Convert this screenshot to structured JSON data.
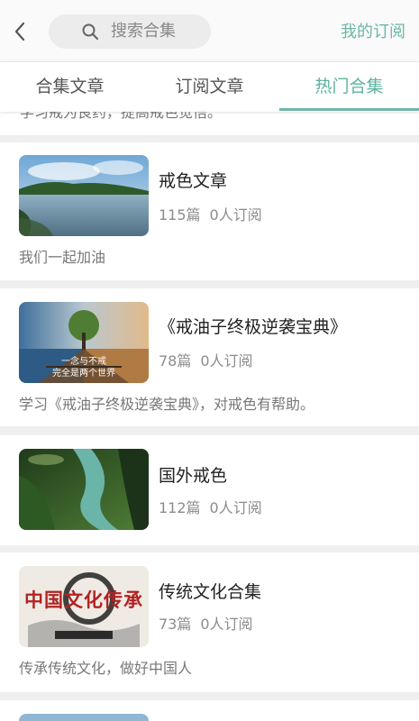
{
  "header": {
    "search_placeholder": "搜索合集",
    "my_subscriptions": "我的订阅"
  },
  "tabs": [
    {
      "label": "合集文章",
      "active": false
    },
    {
      "label": "订阅文章",
      "active": false
    },
    {
      "label": "热门合集",
      "active": true
    }
  ],
  "partial_desc": "学习戒为良药，提高戒色觉悟。",
  "collections": [
    {
      "title": "戒色文章",
      "articles": "115篇",
      "subscribers": "0人订阅",
      "desc": "我们一起加油"
    },
    {
      "title": "《戒油子终极逆袭宝典》",
      "articles": "78篇",
      "subscribers": "0人订阅",
      "desc": "学习《戒油子终极逆袭宝典》，对戒色有帮助。",
      "thumb_text_line1": "一念与不戒",
      "thumb_text_line2": "完全是两个世界"
    },
    {
      "title": "国外戒色",
      "articles": "112篇",
      "subscribers": "0人订阅",
      "desc": ""
    },
    {
      "title": "传统文化合集",
      "articles": "73篇",
      "subscribers": "0人订阅",
      "desc": "传承传统文化，做好中国人",
      "thumb_text_line1": "中国文化传承"
    }
  ],
  "colors": {
    "accent": "#6cb7a6",
    "background": "#efefef"
  }
}
